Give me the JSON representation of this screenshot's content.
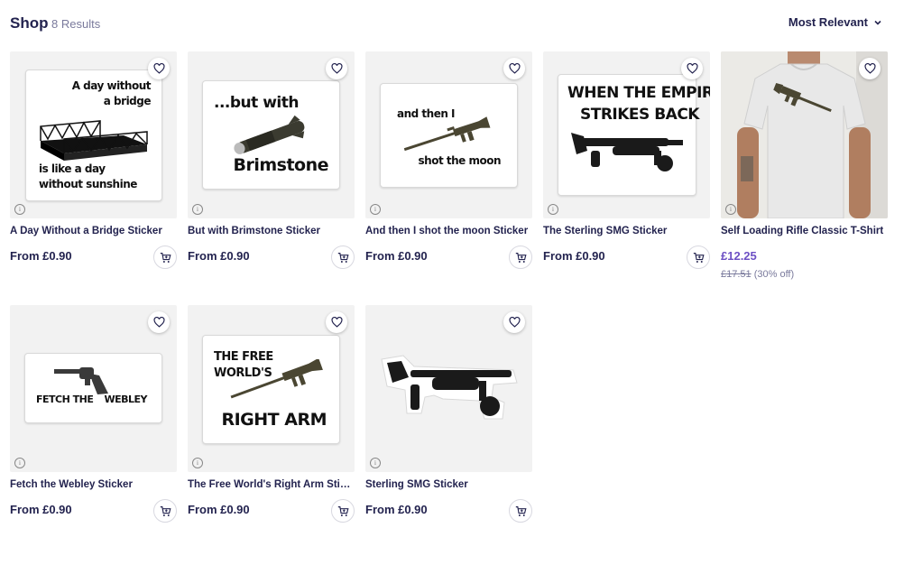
{
  "header": {
    "title": "Shop",
    "results": "8 Results",
    "sort_label": "Most Relevant"
  },
  "products": [
    {
      "title": "A Day Without a Bridge Sticker",
      "price": "From £0.90",
      "art": {
        "line1": "A day without",
        "line2": "a bridge",
        "line3": "is like a day",
        "line4": "without sunshine"
      }
    },
    {
      "title": "But with Brimstone Sticker",
      "price": "From £0.90",
      "art": {
        "line1": "...but with",
        "line2": "Brimstone"
      }
    },
    {
      "title": "And then I shot the moon Sticker",
      "price": "From £0.90",
      "art": {
        "line1": "and then I",
        "line2": "shot the moon"
      }
    },
    {
      "title": "The Sterling SMG Sticker",
      "price": "From £0.90",
      "art": {
        "line1": "WHEN THE EMPIRE",
        "line2": "STRIKES BACK"
      }
    },
    {
      "title": "Self Loading Rifle Classic T-Shirt",
      "price": "£12.25",
      "original_price": "£17.51",
      "discount": "(30% off)"
    },
    {
      "title": "Fetch the Webley Sticker",
      "price": "From £0.90",
      "art": {
        "line1": "FETCH THE",
        "line2": "WEBLEY"
      }
    },
    {
      "title": "The Free World's Right Arm Sticker",
      "price": "From £0.90",
      "art": {
        "line1": "THE FREE",
        "line2": "WORLD'S",
        "line3": "RIGHT ARM"
      }
    },
    {
      "title": "Sterling SMG Sticker",
      "price": "From £0.90"
    }
  ],
  "icons": {
    "favorite": "heart-icon",
    "cart": "add-to-cart-icon",
    "info": "info-icon",
    "sort": "chevron-down-icon"
  },
  "colors": {
    "text": "#23234f",
    "sale_price": "#6c4fc4",
    "muted": "#7a7a9c",
    "thumb_bg": "#f2f2f2"
  }
}
